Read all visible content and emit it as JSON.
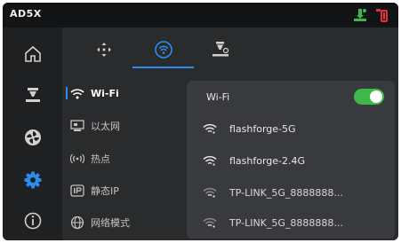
{
  "topbar": {
    "model": "AD5X",
    "status_icons": [
      "printer-status-icon",
      "filament-spool-icon"
    ]
  },
  "sidebar": {
    "items": [
      {
        "icon": "home-icon",
        "active": false
      },
      {
        "icon": "print-head-icon",
        "active": false
      },
      {
        "icon": "fan-icon",
        "active": false
      },
      {
        "icon": "settings-gear-icon",
        "active": true
      },
      {
        "icon": "info-icon",
        "active": false
      }
    ]
  },
  "tabs": [
    {
      "icon": "move-axes-icon",
      "active": false
    },
    {
      "icon": "wifi-circle-icon",
      "active": true
    },
    {
      "icon": "nozzle-calibration-icon",
      "active": false
    }
  ],
  "menu": {
    "items": [
      {
        "label": "Wi-Fi",
        "icon": "wifi-icon",
        "active": true
      },
      {
        "label": "以太网",
        "icon": "ethernet-icon",
        "active": false
      },
      {
        "label": "热点",
        "icon": "hotspot-icon",
        "active": false
      },
      {
        "label": "静态IP",
        "icon": "static-ip-icon",
        "active": false
      },
      {
        "label": "网络模式",
        "icon": "globe-icon",
        "active": false
      }
    ]
  },
  "wifi_panel": {
    "header_label": "Wi-Fi",
    "toggle_on": true,
    "networks": [
      {
        "ssid": "flashforge-5G",
        "signal": "strong"
      },
      {
        "ssid": "flashforge-2.4G",
        "signal": "strong"
      },
      {
        "ssid": "TP-LINK_5G_8888888...",
        "signal": "weak"
      },
      {
        "ssid": "TP-LINK_5G_8888888...",
        "signal": "weak"
      }
    ]
  },
  "colors": {
    "accent": "#2d8cf0",
    "toggle_on": "#3fb84a",
    "status_green": "#3fb84a",
    "status_red": "#e0303a"
  }
}
